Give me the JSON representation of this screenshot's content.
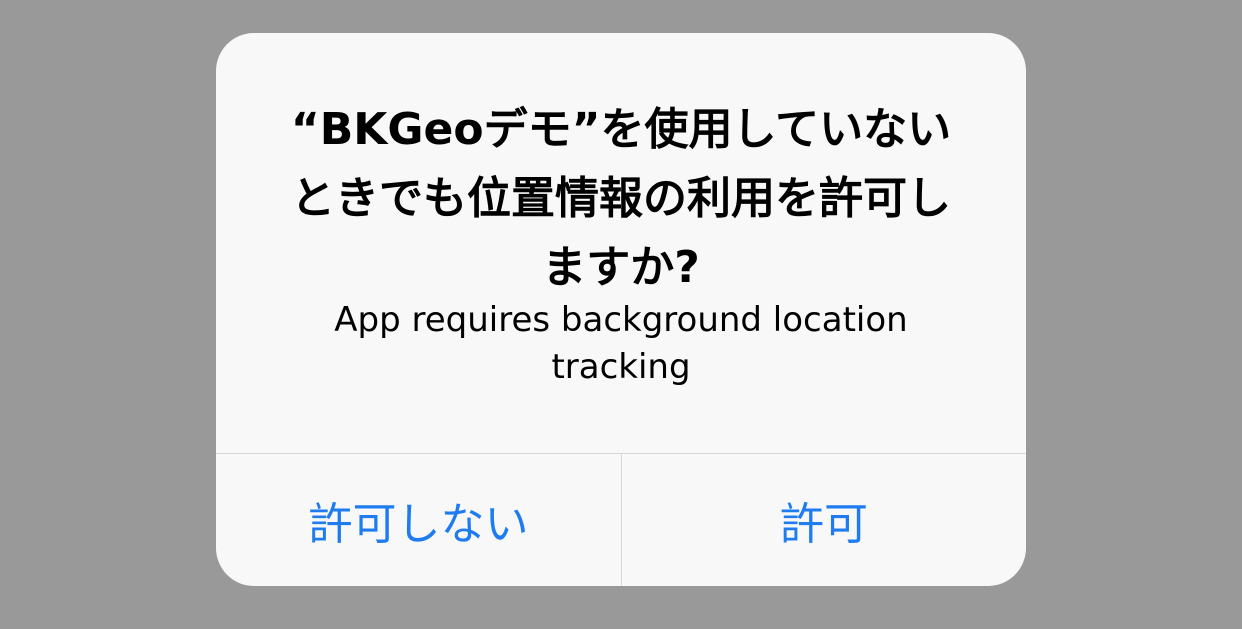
{
  "alert": {
    "title": "“BKGeoデモ”を使用していないときでも位置情報の利用を許可しますか?",
    "message": "App requires background location tracking",
    "buttons": {
      "deny_label": "許可しない",
      "allow_label": "許可"
    }
  },
  "colors": {
    "backdrop": "#999999",
    "alert_background": "#f8f8f8",
    "button_text": "#1e7cf0",
    "divider": "#d6d6d6"
  }
}
